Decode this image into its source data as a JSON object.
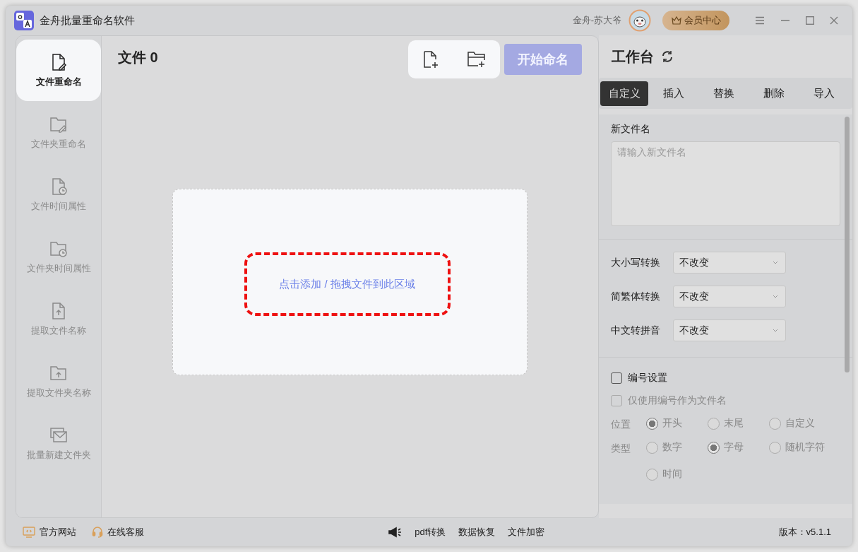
{
  "window": {
    "title": "金舟批量重命名软件",
    "user": "金舟-苏大爷",
    "vip_button": "会员中心"
  },
  "sidebar": {
    "items": [
      {
        "label": "文件重命名",
        "selected": true
      },
      {
        "label": "文件夹重命名",
        "selected": false
      },
      {
        "label": "文件时间属性",
        "selected": false
      },
      {
        "label": "文件夹时间属性",
        "selected": false
      },
      {
        "label": "提取文件名称",
        "selected": false
      },
      {
        "label": "提取文件夹名称",
        "selected": false
      },
      {
        "label": "批量新建文件夹",
        "selected": false
      }
    ]
  },
  "main": {
    "title": "文件 0",
    "start_button": "开始命名",
    "dropzone_text": "点击添加 / 拖拽文件到此区域"
  },
  "workbench": {
    "title": "工作台",
    "tabs": [
      {
        "label": "自定义",
        "selected": true
      },
      {
        "label": "插入",
        "selected": false
      },
      {
        "label": "替换",
        "selected": false
      },
      {
        "label": "删除",
        "selected": false
      },
      {
        "label": "导入",
        "selected": false
      }
    ],
    "new_name": {
      "label": "新文件名",
      "placeholder": "请输入新文件名"
    },
    "conversions": [
      {
        "label": "大小写转换",
        "value": "不改变"
      },
      {
        "label": "简繁体转换",
        "value": "不改变"
      },
      {
        "label": "中文转拼音",
        "value": "不改变"
      }
    ],
    "numbering": {
      "checkbox": {
        "label": "编号设置",
        "checked": false
      },
      "only_number": {
        "label": "仅使用编号作为文件名",
        "checked": false,
        "disabled": true
      },
      "groups": [
        {
          "label": "位置",
          "options": [
            {
              "label": "开头",
              "selected": true
            },
            {
              "label": "末尾",
              "selected": false
            },
            {
              "label": "自定义",
              "selected": false
            }
          ]
        },
        {
          "label": "类型",
          "options": [
            {
              "label": "数字",
              "selected": false
            },
            {
              "label": "字母",
              "selected": true
            },
            {
              "label": "随机字符",
              "selected": false
            },
            {
              "label": "时间",
              "selected": false
            }
          ]
        }
      ]
    }
  },
  "footer": {
    "left": [
      {
        "label": "官方网站",
        "kind": "web"
      },
      {
        "label": "在线客服",
        "kind": "support"
      }
    ],
    "center": [
      "pdf转换",
      "数据恢复",
      "文件加密"
    ],
    "version": "版本：v5.1.1"
  }
}
